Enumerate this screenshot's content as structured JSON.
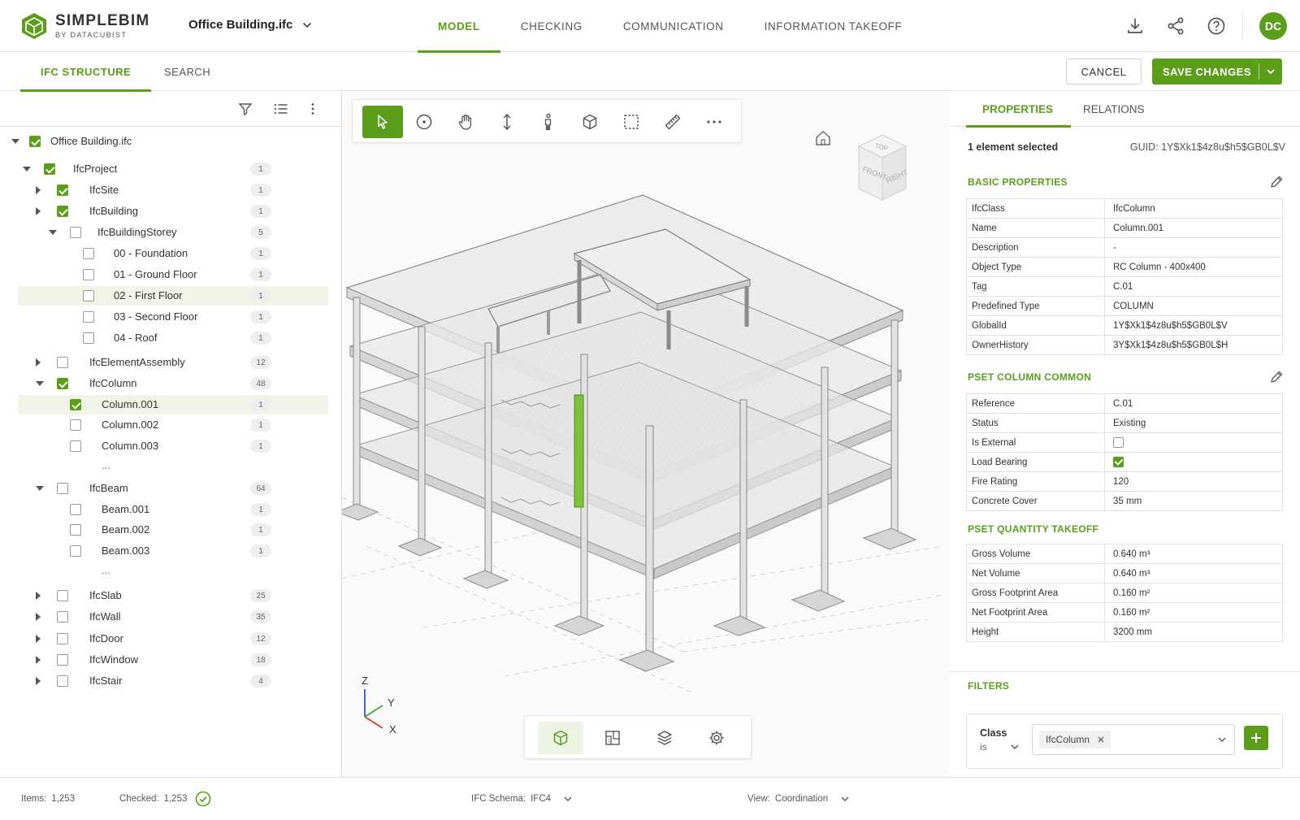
{
  "app": {
    "brand": "SIMPLEBIM",
    "brand_sub": "BY DATACUBIST",
    "file_name": "Office Building.ifc",
    "user_initials": "DC",
    "accent": "#5a9e1a"
  },
  "nav": {
    "tabs": [
      {
        "label": "MODEL",
        "active": true
      },
      {
        "label": "CHECKING",
        "active": false
      },
      {
        "label": "COMMUNICATION",
        "active": false
      },
      {
        "label": "INFORMATION TAKEOFF",
        "active": false
      }
    ],
    "icons": [
      "download-icon",
      "share-icon",
      "help-icon"
    ]
  },
  "subnav": {
    "tabs": [
      {
        "label": "IFC STRUCTURE",
        "active": true
      },
      {
        "label": "SEARCH",
        "active": false
      }
    ],
    "cancel_label": "CANCEL",
    "save_label": "SAVE CHANGES"
  },
  "tree": [
    {
      "label": "Office Building.ifc",
      "level": 0,
      "expand": "down",
      "checked": true,
      "count": null
    },
    {
      "label": "IfcProject",
      "level": 1,
      "expand": "down",
      "checked": true,
      "count": "1"
    },
    {
      "label": "IfcSite",
      "level": 2,
      "expand": "right",
      "checked": true,
      "count": "1"
    },
    {
      "label": "IfcBuilding",
      "level": 2,
      "expand": "right",
      "checked": true,
      "count": "1"
    },
    {
      "label": "IfcBuildingStorey",
      "level": 3,
      "expand": "down",
      "checked": false,
      "count": "5"
    },
    {
      "label": "00 - Foundation",
      "level": 4,
      "checked": false,
      "count": "1"
    },
    {
      "label": "01 - Ground Floor",
      "level": 4,
      "checked": false,
      "count": "1"
    },
    {
      "label": "02 - First Floor",
      "level": 4,
      "checked": false,
      "count": "1",
      "highlight": true
    },
    {
      "label": "03 - Second Floor",
      "level": 4,
      "checked": false,
      "count": "1"
    },
    {
      "label": "04 - Roof",
      "level": 4,
      "checked": false,
      "count": "1"
    },
    {
      "label": "IfcElementAssembly",
      "level": 2,
      "expand": "right",
      "checked": false,
      "count": "12"
    },
    {
      "label": "IfcColumn",
      "level": 2,
      "expand": "down",
      "checked": true,
      "count": "48"
    },
    {
      "label": "Column.001",
      "level": 3,
      "checked": true,
      "count": "1",
      "highlight": true
    },
    {
      "label": "Column.002",
      "level": 3,
      "checked": false,
      "count": "1"
    },
    {
      "label": "Column.003",
      "level": 3,
      "checked": false,
      "count": "1"
    },
    {
      "label": "...",
      "level": 3,
      "ellipsis": true
    },
    {
      "label": "IfcBeam",
      "level": 2,
      "expand": "down",
      "checked": false,
      "count": "64"
    },
    {
      "label": "Beam.001",
      "level": 3,
      "checked": false,
      "count": "1"
    },
    {
      "label": "Beam.002",
      "level": 3,
      "checked": false,
      "count": "1"
    },
    {
      "label": "Beam.003",
      "level": 3,
      "checked": false,
      "count": "1"
    },
    {
      "label": "...",
      "level": 3,
      "ellipsis": true
    },
    {
      "label": "IfcSlab",
      "level": 2,
      "expand": "right",
      "checked": false,
      "count": "25"
    },
    {
      "label": "IfcWall",
      "level": 2,
      "expand": "right",
      "checked": false,
      "count": "35"
    },
    {
      "label": "IfcDoor",
      "level": 2,
      "expand": "right",
      "checked": false,
      "count": "12"
    },
    {
      "label": "IfcWindow",
      "level": 2,
      "expand": "right",
      "checked": false,
      "count": "18"
    },
    {
      "label": "IfcStair",
      "level": 2,
      "expand": "right",
      "checked": false,
      "count": "4"
    }
  ],
  "viewer": {
    "tools": [
      "select-icon",
      "orbit-icon",
      "pan-icon",
      "vertical-move-icon",
      "walk-icon",
      "box-view-icon",
      "box-select-icon",
      "measure-icon",
      "more-icon"
    ],
    "bottom_tools": [
      "3d-view-icon",
      "floorplan-icon",
      "layers-icon",
      "settings-icon"
    ],
    "cube": {
      "top": "TOP",
      "front": "FRONT",
      "right": "RIGHT"
    },
    "axes": {
      "z": "Z",
      "y": "Y",
      "x": "X"
    },
    "highlight_color": "#7bc23a"
  },
  "properties": {
    "tabs": [
      {
        "label": "PROPERTIES",
        "active": true
      },
      {
        "label": "RELATIONS",
        "active": false
      }
    ],
    "selection": "1 element selected",
    "guid": "GUID: 1Y$Xk1$4z8u$h5$GB0L$V",
    "basic_title": "BASIC PROPERTIES",
    "basic": [
      [
        "IfcClass",
        "IfcColumn"
      ],
      [
        "Name",
        "Column.001"
      ],
      [
        "Description",
        "-"
      ],
      [
        "Object Type",
        "RC Column - 400x400"
      ],
      [
        "Tag",
        "C.01"
      ],
      [
        "Predefined Type",
        "COLUMN"
      ],
      [
        "GlobalId",
        "1Y$Xk1$4z8u$h5$GB0L$V"
      ],
      [
        "OwnerHistory",
        "3Y$Xk1$4z8u$h5$GB0L$H"
      ]
    ],
    "pset_title": "PSET COLUMN COMMON",
    "pset": [
      [
        "Reference",
        "C.01"
      ],
      [
        "Status",
        "Existing"
      ],
      [
        "Is External",
        false
      ],
      [
        "Load Bearing",
        true
      ],
      [
        "Fire Rating",
        "120"
      ],
      [
        "Concrete Cover",
        "35 mm"
      ]
    ],
    "qto_title": "PSET QUANTITY TAKEOFF",
    "qto": [
      [
        "Gross Volume",
        "0.640 m³"
      ],
      [
        "Net Volume",
        "0.640 m³"
      ],
      [
        "Gross Footprint Area",
        "0.160 m²"
      ],
      [
        "Net Footprint Area",
        "0.160 m²"
      ],
      [
        "Height",
        "3200 mm"
      ]
    ],
    "filters_title": "FILTERS",
    "filter": {
      "field": "Class",
      "op": "is",
      "value": "IfcColumn"
    }
  },
  "status": {
    "items_label": "Items:",
    "items_value": "1,253",
    "checked_label": "Checked:",
    "checked_value": "1,253",
    "schema_label": "IFC Schema:",
    "schema_value": "IFC4",
    "view_label": "View:",
    "view_value": "Coordination"
  }
}
